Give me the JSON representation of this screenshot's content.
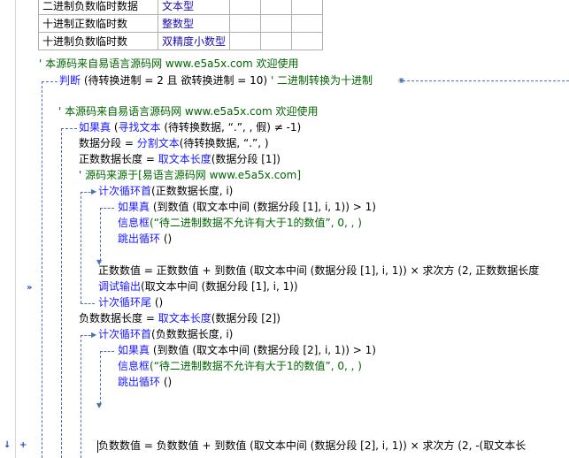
{
  "vars_table": [
    {
      "name": "二进制负数临时数据",
      "type": "文本型"
    },
    {
      "name": "十进制正数临时数",
      "type": "整数型"
    },
    {
      "name": "十进制负数临时数",
      "type": "双精度小数型"
    }
  ],
  "lines": {
    "l1": "' 本源码来自易语言源码网 www.e5a5x.com  欢迎使用",
    "l2_kw": "判断",
    "l2_body": "(待转换进制 = 2 且 欲转换进制 = 10)",
    "l2_cm": "' 二进制转换为十进制",
    "l3": "' 本源码来自易语言源码网 www.e5a5x.com  欢迎使用",
    "l4_kw": "如果真",
    "l4_fn": "寻找文本",
    "l4_body": "(待转换数据, “.”, , 假) ≠ -1)",
    "l5_a": "数据分段 = ",
    "l5_fn": "分割文本",
    "l5_b": "(待转换数据, “.”, )",
    "l6_a": "正数数据长度 = ",
    "l6_fn": "取文本长度",
    "l6_b": "(数据分段 [1])",
    "l7": "' 源码来源于[易语言源码网 www.e5a5x.com]",
    "l8_kw": "计次循环首",
    "l8_b": "(正数数据长度, i)",
    "l9_kw": "如果真",
    "l9_b": "(到数值 (取文本中间 (数据分段 [1], i, 1)) > 1)",
    "l10_fn": "信息框",
    "l10_st": "(“待二进制数据不允许有大于1的数值”, 0, , )",
    "l11_kw": "跳出循环",
    "l11_b": "()",
    "l12": "正数数值 = 正数数值 + 到数值 (取文本中间 (数据分段 [1], i, 1)) × 求次方 (2, 正数数据长度",
    "l13_fn": "调试输出",
    "l13_b": "(取文本中间 (数据分段 [1], i, 1))",
    "l14_kw": "计次循环尾",
    "l14_b": "()",
    "l15_a": "负数数据长度 = ",
    "l15_fn": "取文本长度",
    "l15_b": "(数据分段 [2])",
    "l16_kw": "计次循环首",
    "l16_b": "(负数数据长度, i)",
    "l17_kw": "如果真",
    "l17_b": "(到数值 (取文本中间 (数据分段 [2], i, 1)) > 1)",
    "l18_fn": "信息框",
    "l18_st": "(“待二进制数据不允许有大于1的数值”, 0, , )",
    "l19_kw": "跳出循环",
    "l19_b": "()",
    "l20": "负数数值 = 负数数值 + 到数值 (取文本中间 (数据分段 [2], i, 1)) × 求次方 (2, -(取文本长"
  },
  "gutter": {
    "break_marker": "»",
    "arrow_marker": "↓",
    "plus_marker": "+"
  },
  "colors": {
    "keyword": "#1a1aff",
    "comment": "#006400",
    "flow": "#4a6fb5",
    "gutter_mark": "#1f4fbf"
  }
}
